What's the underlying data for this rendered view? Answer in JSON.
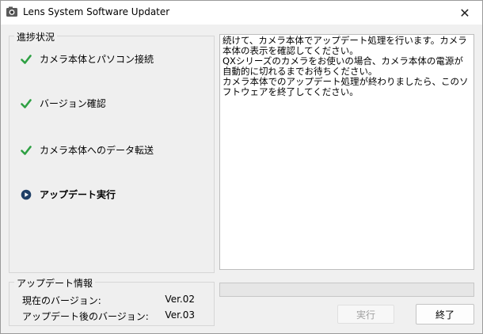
{
  "window": {
    "title": "Lens System Software Updater",
    "close_glyph": "✕"
  },
  "progress_group": {
    "label": "進捗状況",
    "steps": [
      {
        "label": "カメラ本体とパソコン接続",
        "state": "done",
        "icon": "check-icon"
      },
      {
        "label": "バージョン確認",
        "state": "done",
        "icon": "check-icon"
      },
      {
        "label": "カメラ本体へのデータ転送",
        "state": "done",
        "icon": "check-icon"
      },
      {
        "label": "アップデート実行",
        "state": "current",
        "icon": "play-icon"
      }
    ]
  },
  "message": {
    "text": "続けて、カメラ本体でアップデート処理を行います。カメラ本体の表示を確認してください。\nQXシリーズのカメラをお使いの場合、カメラ本体の電源が自動的に切れるまでお待ちください。\nカメラ本体でのアップデート処理が終わりましたら、このソフトウェアを終了してください。"
  },
  "info_group": {
    "label": "アップデート情報",
    "current_label": "現在のバージョン:",
    "current_value": "Ver.02",
    "after_label": "アップデート後のバージョン:",
    "after_value": "Ver.03"
  },
  "progress_bar": {
    "value": 0
  },
  "buttons": {
    "run_label": "実行",
    "exit_label": "終了"
  },
  "colors": {
    "check": "#2ea043",
    "current_icon": "#1f3f66"
  }
}
